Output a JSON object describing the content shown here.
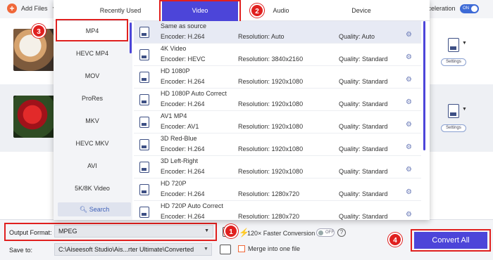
{
  "topbar": {
    "add_files": "Add Files",
    "acceleration": "cceleration",
    "accel_toggle": "ON"
  },
  "rows": [
    {
      "settings": "Settings"
    },
    {
      "settings": "Settings"
    }
  ],
  "panel": {
    "tabs": [
      "Recently Used",
      "Video",
      "Audio",
      "Device"
    ],
    "active_tab": "Video",
    "categories": [
      "MP4",
      "HEVC MP4",
      "MOV",
      "ProRes",
      "MKV",
      "HEVC MKV",
      "AVI",
      "5K/8K Video"
    ],
    "active_category": "MP4",
    "search_label": "Search",
    "presets": [
      {
        "name": "Same as source",
        "encoder": "Encoder: H.264",
        "resolution": "Resolution: Auto",
        "quality": "Quality: Auto"
      },
      {
        "name": "4K Video",
        "encoder": "Encoder: HEVC",
        "resolution": "Resolution: 3840x2160",
        "quality": "Quality: Standard"
      },
      {
        "name": "HD 1080P",
        "encoder": "Encoder: H.264",
        "resolution": "Resolution: 1920x1080",
        "quality": "Quality: Standard"
      },
      {
        "name": "HD 1080P Auto Correct",
        "encoder": "Encoder: H.264",
        "resolution": "Resolution: 1920x1080",
        "quality": "Quality: Standard"
      },
      {
        "name": "AV1 MP4",
        "encoder": "Encoder: AV1",
        "resolution": "Resolution: 1920x1080",
        "quality": "Quality: Standard"
      },
      {
        "name": "3D Red-Blue",
        "encoder": "Encoder: H.264",
        "resolution": "Resolution: 1920x1080",
        "quality": "Quality: Standard"
      },
      {
        "name": "3D Left-Right",
        "encoder": "Encoder: H.264",
        "resolution": "Resolution: 1920x1080",
        "quality": "Quality: Standard"
      },
      {
        "name": "HD 720P",
        "encoder": "Encoder: H.264",
        "resolution": "Resolution: 1280x720",
        "quality": "Quality: Standard"
      },
      {
        "name": "HD 720P Auto Correct",
        "encoder": "Encoder: H.264",
        "resolution": "Resolution: 1280x720",
        "quality": "Quality: Standard"
      }
    ]
  },
  "bottom": {
    "output_format_label": "Output Format:",
    "output_format_value": "MPEG",
    "save_to_label": "Save to:",
    "save_to_value": "C:\\Aiseesoft Studio\\Ais...rter Ultimate\\Converted",
    "faster_conversion": "120× Faster Conversion",
    "faster_toggle": "OFF",
    "help": "?",
    "merge_label": "Merge into one file",
    "convert_all": "Convert All"
  },
  "badges": [
    "1",
    "2",
    "3",
    "4"
  ],
  "colors": {
    "accent": "#4c45d9",
    "highlight": "#e0201f",
    "orange": "#f0683a"
  }
}
